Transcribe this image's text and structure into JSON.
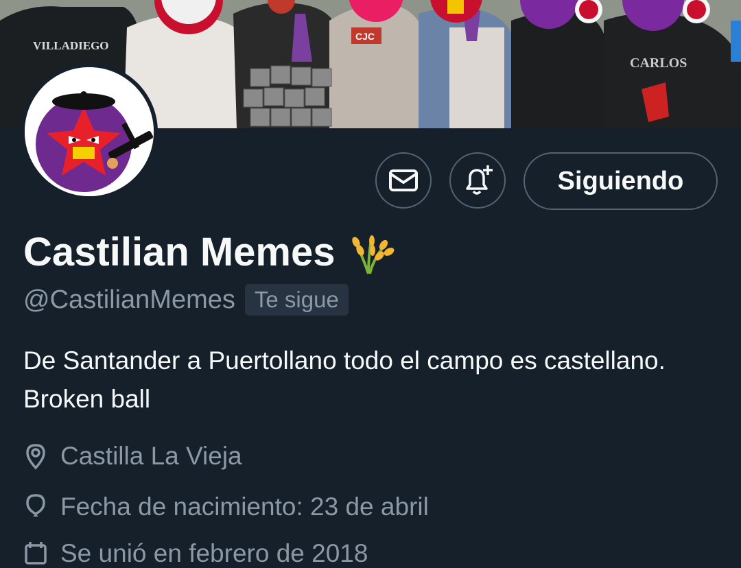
{
  "profile": {
    "display_name": "Castilian Memes",
    "name_emoji": "sheaf-of-rice-icon",
    "handle": "@CastilianMemes",
    "follows_you_badge": "Te sigue",
    "bio": "De Santander a Puertollano todo el campo es castellano. Broken ball",
    "location": "Castilla La Vieja",
    "birthday": "Fecha de nacimiento: 23 de abril",
    "joined": "Se unió en febrero de 2018"
  },
  "actions": {
    "message_icon": "envelope-icon",
    "notify_icon": "bell-plus-icon",
    "follow_label": "Siguiendo"
  },
  "banner": {
    "shirt_text_1": "VILLADIEGO",
    "shirt_text_2": "CJC",
    "shirt_text_3": "CARLOS"
  },
  "colors": {
    "background": "#15202b",
    "secondary_text": "#8b98a5",
    "border": "#536471"
  }
}
